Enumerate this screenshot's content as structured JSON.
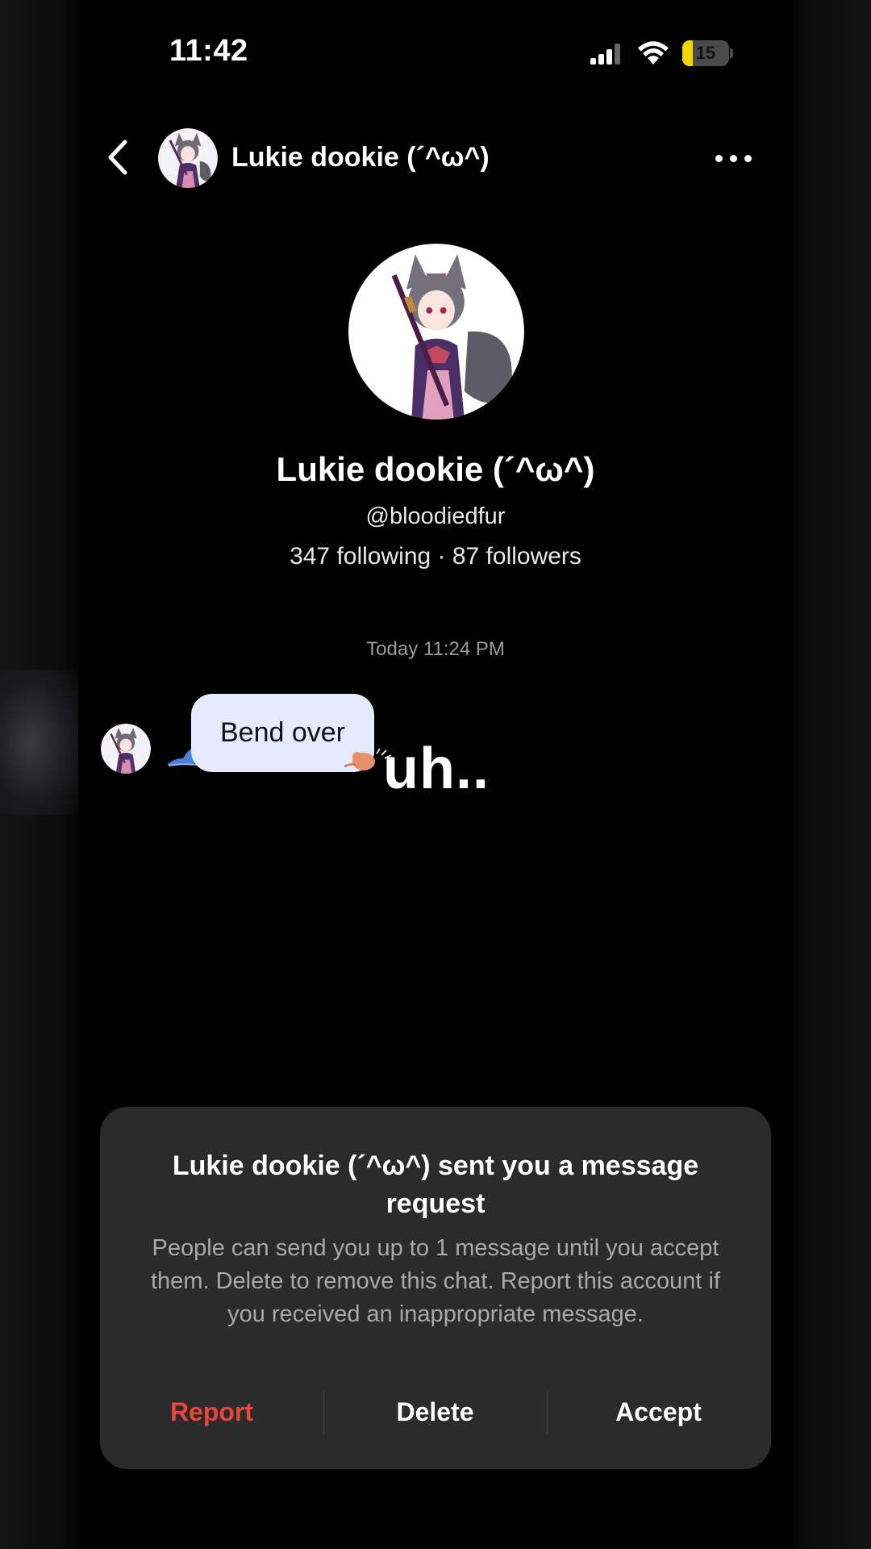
{
  "status_bar": {
    "time": "11:42",
    "battery_level": "15",
    "battery_color": "#f5d500",
    "icons": [
      "cellular-signal-icon",
      "wifi-icon",
      "battery-icon"
    ]
  },
  "header": {
    "back_icon": "chevron-left-icon",
    "name": "Lukie dookie (´^ω^)",
    "more_icon": "more-horizontal-icon"
  },
  "profile": {
    "name": "Lukie dookie (´^ω^)",
    "handle": "@bloodiedfur",
    "stats": "347 following · 87 followers"
  },
  "conversation": {
    "timestamp": "Today 11:24 PM",
    "messages": [
      {
        "text": "Bend over",
        "bubble_color": "#e6eaff"
      }
    ],
    "overlay_text": "uh.."
  },
  "message_request": {
    "title": "Lukie dookie (´^ω^) sent you a message request",
    "body": "People can send you up to 1 message until you accept them. Delete to remove this chat. Report this account if you received an inappropriate message.",
    "actions": {
      "report": "Report",
      "delete": "Delete",
      "accept": "Accept"
    },
    "report_color": "#e8453c"
  }
}
